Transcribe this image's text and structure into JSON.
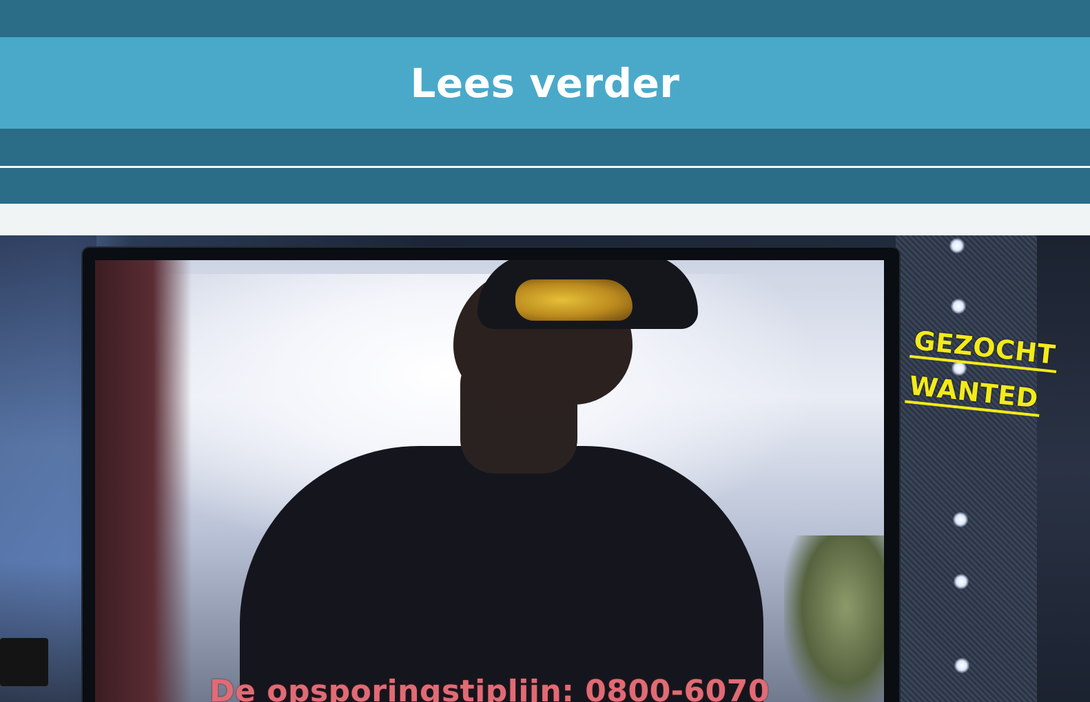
{
  "cta": {
    "label": "Lees verder"
  },
  "hero": {
    "caption": "De opsporingstiplijn: 0800-6070",
    "stamp": {
      "line1": "GEZOCHT",
      "line2": "WANTED"
    }
  },
  "colors": {
    "band_dark": "#2b6c87",
    "cta_bg": "#4aa9c9",
    "caption_text": "#e06b75",
    "stamp_text": "#f3ea1a"
  }
}
